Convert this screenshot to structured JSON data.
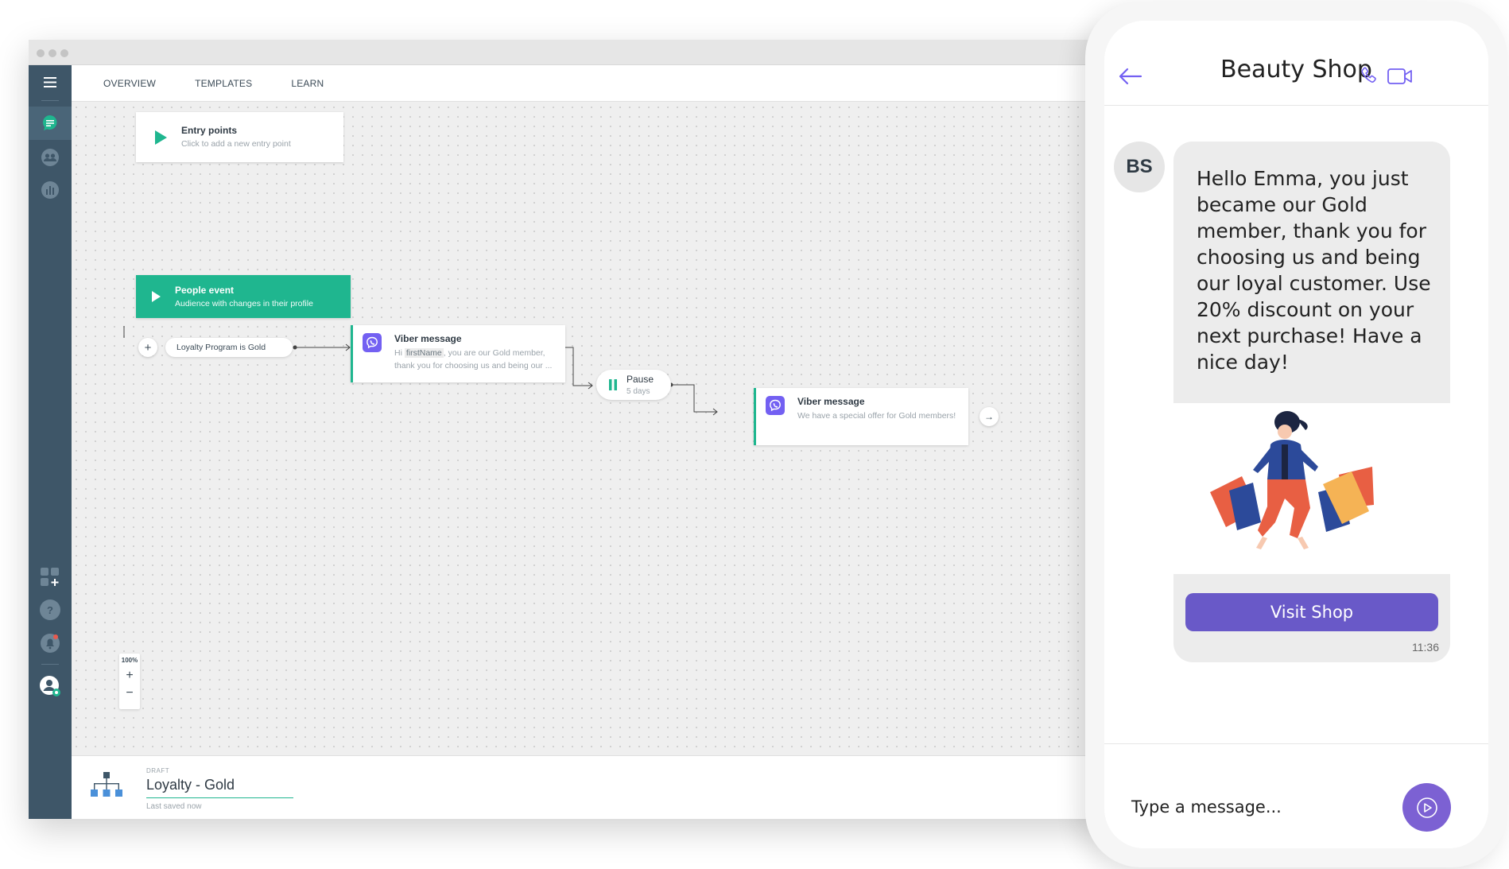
{
  "app": {
    "nav_tabs": [
      {
        "label": "OVERVIEW"
      },
      {
        "label": "TEMPLATES"
      },
      {
        "label": "LEARN"
      }
    ],
    "sidebar": {
      "icons": [
        "menu-icon",
        "chat-icon",
        "people-icon",
        "analytics-icon",
        "add-app-icon",
        "help-icon",
        "notification-icon",
        "user-avatar-icon"
      ],
      "help_glyph": "?"
    }
  },
  "canvas": {
    "entry_node": {
      "title": "Entry points",
      "subtitle": "Click to add a new entry point"
    },
    "event_node": {
      "title": "People event",
      "subtitle": "Audience with changes in their profile"
    },
    "condition": {
      "label": "Loyalty Program is Gold",
      "add_glyph": "+"
    },
    "viber_message_1": {
      "title": "Viber message",
      "line1_prefix": "Hi ",
      "line1_var": "firstName",
      "line1_suffix": ", you are our Gold member,",
      "line2": "thank you for choosing us and being our ..."
    },
    "pause_node": {
      "title": "Pause",
      "subtitle": "5 days"
    },
    "viber_message_2": {
      "title": "Viber message",
      "subtitle": "We have a special offer for Gold members!"
    },
    "end_arrow": "→",
    "zoom": {
      "level": "100%",
      "plus": "+",
      "minus": "−"
    }
  },
  "footer": {
    "status": "DRAFT",
    "flow_name": "Loyalty - Gold",
    "saved_text": "Last saved now"
  },
  "phone": {
    "contact_name": "Beauty Shop",
    "avatar_initials": "BS",
    "message_text": "Hello Emma, you just became our Gold member, thank you for choosing us and being our loyal customer. Use 20% discount on your next purchase! Have a nice day!",
    "button_label": "Visit Shop",
    "message_time": "11:36",
    "composer_placeholder": "Type a message..."
  },
  "colors": {
    "sidebar": "#3e5668",
    "accent_green": "#1fb68f",
    "viber_purple": "#7360f2",
    "button_purple": "#6959c8"
  }
}
